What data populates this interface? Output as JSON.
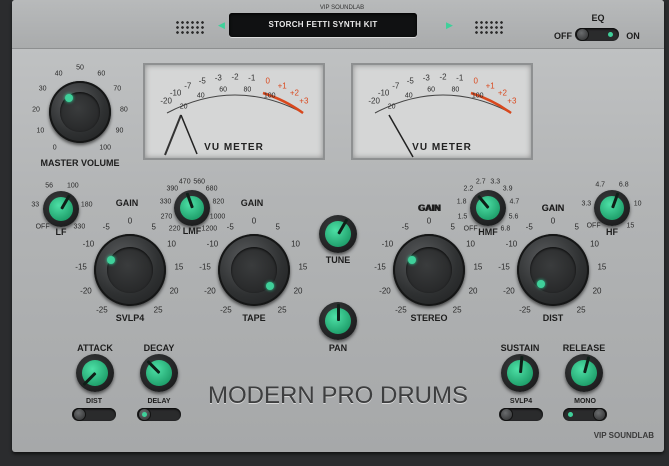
{
  "header": {
    "brand_small": "VIP SOUNDLAB",
    "preset_name": "STORCH FETTI SYNTH KIT",
    "prev_icon": "chevron-left-icon",
    "next_icon": "chevron-right-icon",
    "eq": {
      "title": "EQ",
      "off": "OFF",
      "on": "ON",
      "state": "on"
    }
  },
  "master": {
    "label": "MASTER VOLUME",
    "ticks": [
      "0",
      "10",
      "20",
      "30",
      "40",
      "50",
      "60",
      "70",
      "80",
      "90",
      "100"
    ]
  },
  "vu_meters": [
    {
      "label": "VU METER",
      "scale": [
        "-20",
        "-10",
        "-7",
        "-5",
        "-3",
        "-2",
        "-1",
        "0",
        "+1",
        "+2",
        "+3"
      ],
      "inner": [
        "20",
        "40",
        "60",
        "80",
        "100"
      ]
    },
    {
      "label": "VU METER",
      "scale": [
        "-20",
        "-10",
        "-7",
        "-5",
        "-3",
        "-2",
        "-1",
        "0",
        "+1",
        "+2",
        "+3"
      ],
      "inner": [
        "20",
        "40",
        "60",
        "80",
        "100"
      ]
    }
  ],
  "eq_bands": {
    "lf": {
      "label": "LF",
      "ticks": [
        "OFF",
        "33",
        "56",
        "100",
        "180",
        "330"
      ]
    },
    "lmf": {
      "label": "LMF",
      "gain": "GAIN",
      "ticks": [
        "220",
        "270",
        "330",
        "390",
        "470",
        "560",
        "680",
        "820",
        "1000",
        "1200"
      ]
    },
    "hmf": {
      "label": "HMF",
      "gain": "GAIN",
      "ticks": [
        "OFF",
        "1.5",
        "1.8",
        "2.2",
        "2.7",
        "3.3",
        "3.9",
        "4.7",
        "5.6",
        "6.8"
      ]
    },
    "hf": {
      "label": "HF",
      "gain": "GAIN",
      "ticks": [
        "OFF",
        "3.3",
        "4.7",
        "6.8",
        "10",
        "15"
      ]
    }
  },
  "big_knobs": {
    "gain_label": "GAIN",
    "ticks": [
      "-25",
      "-20",
      "-15",
      "-10",
      "-5",
      "0",
      "5",
      "10",
      "15",
      "20",
      "25"
    ],
    "svlp4": {
      "label": "SVLP4"
    },
    "tape": {
      "label": "TAPE"
    },
    "stereo": {
      "label": "STEREO"
    },
    "dist": {
      "label": "DIST"
    }
  },
  "center": {
    "tune": "TUNE",
    "pan": "PAN"
  },
  "envelope": {
    "attack": "ATTACK",
    "decay": "DECAY",
    "sustain": "SUSTAIN",
    "release": "RELEASE",
    "dist_toggle": "DIST",
    "delay_toggle": "DELAY",
    "svlp4_toggle": "SVLP4",
    "mono_toggle": "MONO"
  },
  "product_title": "MODERN PRO DRUMS",
  "footer_brand": "VIP SOUNDLAB"
}
